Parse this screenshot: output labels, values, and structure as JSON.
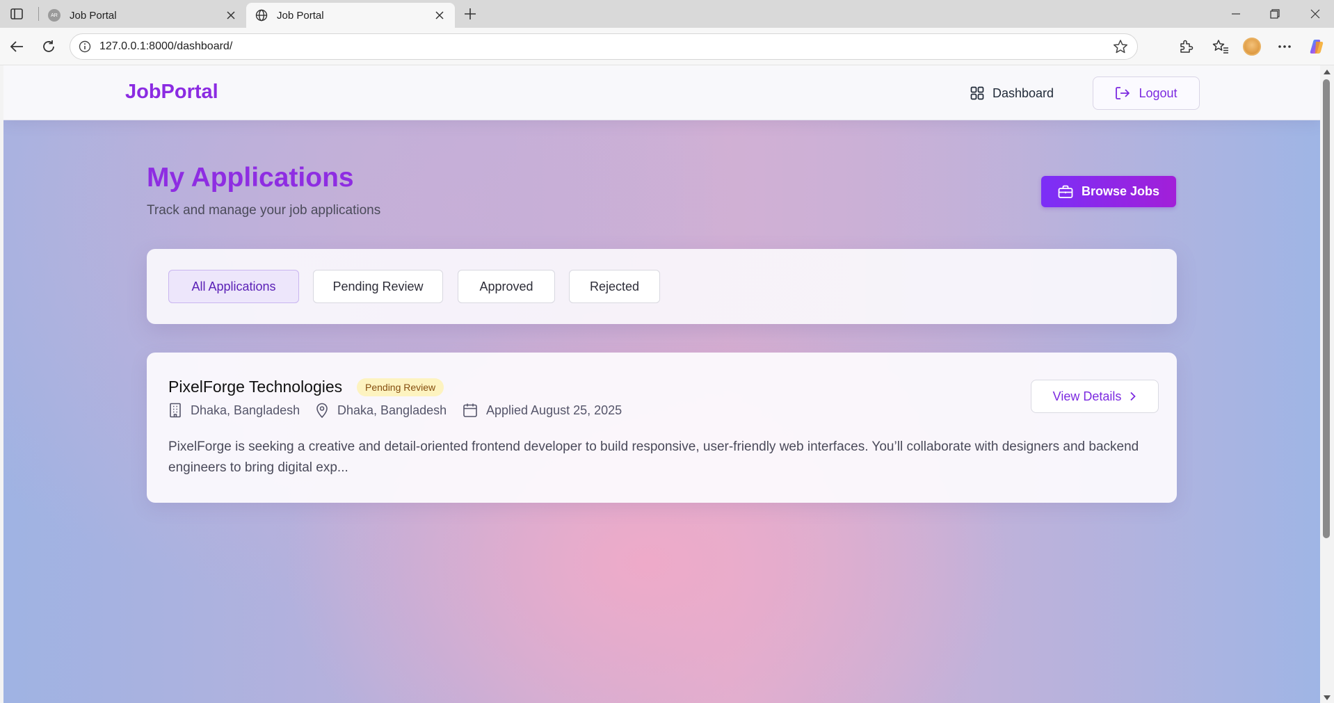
{
  "browser": {
    "tabs": [
      {
        "title": "Job Portal",
        "favicon_text": "AR"
      },
      {
        "title": "Job Portal"
      }
    ],
    "url": "127.0.0.1:8000/dashboard/"
  },
  "site": {
    "brand": "JobPortal",
    "nav": {
      "dashboard_label": "Dashboard",
      "logout_label": "Logout"
    }
  },
  "header": {
    "title": "My Applications",
    "subtitle": "Track and manage your job applications",
    "browse_label": "Browse Jobs"
  },
  "filters": [
    {
      "label": "All Applications",
      "active": true
    },
    {
      "label": "Pending Review",
      "active": false
    },
    {
      "label": "Approved",
      "active": false
    },
    {
      "label": "Rejected",
      "active": false
    }
  ],
  "applications": [
    {
      "company": "PixelForge Technologies",
      "status": "Pending Review",
      "company_location": "Dhaka, Bangladesh",
      "job_location": "Dhaka, Bangladesh",
      "applied": "Applied August 25, 2025",
      "description": "PixelForge is seeking a creative and detail-oriented frontend developer to build responsive, user-friendly web interfaces. You’ll collaborate with designers and backend engineers to bring digital exp...",
      "view_label": "View Details"
    }
  ],
  "colors": {
    "brand": "#8b2be2",
    "primary_button": "#7b2ff7",
    "pending_badge_bg": "#fdf3c0",
    "pending_badge_text": "#854d0e"
  }
}
